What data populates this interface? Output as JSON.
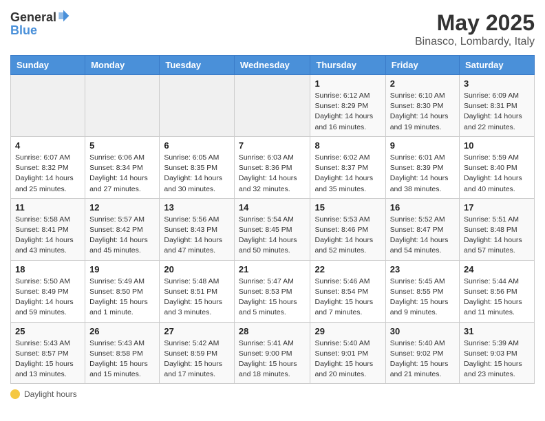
{
  "header": {
    "logo_general": "General",
    "logo_blue": "Blue",
    "month_title": "May 2025",
    "location": "Binasco, Lombardy, Italy"
  },
  "days_of_week": [
    "Sunday",
    "Monday",
    "Tuesday",
    "Wednesday",
    "Thursday",
    "Friday",
    "Saturday"
  ],
  "footer_label": "Daylight hours",
  "weeks": [
    [
      {
        "day": "",
        "info": ""
      },
      {
        "day": "",
        "info": ""
      },
      {
        "day": "",
        "info": ""
      },
      {
        "day": "",
        "info": ""
      },
      {
        "day": "1",
        "info": "Sunrise: 6:12 AM\nSunset: 8:29 PM\nDaylight: 14 hours and 16 minutes."
      },
      {
        "day": "2",
        "info": "Sunrise: 6:10 AM\nSunset: 8:30 PM\nDaylight: 14 hours and 19 minutes."
      },
      {
        "day": "3",
        "info": "Sunrise: 6:09 AM\nSunset: 8:31 PM\nDaylight: 14 hours and 22 minutes."
      }
    ],
    [
      {
        "day": "4",
        "info": "Sunrise: 6:07 AM\nSunset: 8:32 PM\nDaylight: 14 hours and 25 minutes."
      },
      {
        "day": "5",
        "info": "Sunrise: 6:06 AM\nSunset: 8:34 PM\nDaylight: 14 hours and 27 minutes."
      },
      {
        "day": "6",
        "info": "Sunrise: 6:05 AM\nSunset: 8:35 PM\nDaylight: 14 hours and 30 minutes."
      },
      {
        "day": "7",
        "info": "Sunrise: 6:03 AM\nSunset: 8:36 PM\nDaylight: 14 hours and 32 minutes."
      },
      {
        "day": "8",
        "info": "Sunrise: 6:02 AM\nSunset: 8:37 PM\nDaylight: 14 hours and 35 minutes."
      },
      {
        "day": "9",
        "info": "Sunrise: 6:01 AM\nSunset: 8:39 PM\nDaylight: 14 hours and 38 minutes."
      },
      {
        "day": "10",
        "info": "Sunrise: 5:59 AM\nSunset: 8:40 PM\nDaylight: 14 hours and 40 minutes."
      }
    ],
    [
      {
        "day": "11",
        "info": "Sunrise: 5:58 AM\nSunset: 8:41 PM\nDaylight: 14 hours and 43 minutes."
      },
      {
        "day": "12",
        "info": "Sunrise: 5:57 AM\nSunset: 8:42 PM\nDaylight: 14 hours and 45 minutes."
      },
      {
        "day": "13",
        "info": "Sunrise: 5:56 AM\nSunset: 8:43 PM\nDaylight: 14 hours and 47 minutes."
      },
      {
        "day": "14",
        "info": "Sunrise: 5:54 AM\nSunset: 8:45 PM\nDaylight: 14 hours and 50 minutes."
      },
      {
        "day": "15",
        "info": "Sunrise: 5:53 AM\nSunset: 8:46 PM\nDaylight: 14 hours and 52 minutes."
      },
      {
        "day": "16",
        "info": "Sunrise: 5:52 AM\nSunset: 8:47 PM\nDaylight: 14 hours and 54 minutes."
      },
      {
        "day": "17",
        "info": "Sunrise: 5:51 AM\nSunset: 8:48 PM\nDaylight: 14 hours and 57 minutes."
      }
    ],
    [
      {
        "day": "18",
        "info": "Sunrise: 5:50 AM\nSunset: 8:49 PM\nDaylight: 14 hours and 59 minutes."
      },
      {
        "day": "19",
        "info": "Sunrise: 5:49 AM\nSunset: 8:50 PM\nDaylight: 15 hours and 1 minute."
      },
      {
        "day": "20",
        "info": "Sunrise: 5:48 AM\nSunset: 8:51 PM\nDaylight: 15 hours and 3 minutes."
      },
      {
        "day": "21",
        "info": "Sunrise: 5:47 AM\nSunset: 8:53 PM\nDaylight: 15 hours and 5 minutes."
      },
      {
        "day": "22",
        "info": "Sunrise: 5:46 AM\nSunset: 8:54 PM\nDaylight: 15 hours and 7 minutes."
      },
      {
        "day": "23",
        "info": "Sunrise: 5:45 AM\nSunset: 8:55 PM\nDaylight: 15 hours and 9 minutes."
      },
      {
        "day": "24",
        "info": "Sunrise: 5:44 AM\nSunset: 8:56 PM\nDaylight: 15 hours and 11 minutes."
      }
    ],
    [
      {
        "day": "25",
        "info": "Sunrise: 5:43 AM\nSunset: 8:57 PM\nDaylight: 15 hours and 13 minutes."
      },
      {
        "day": "26",
        "info": "Sunrise: 5:43 AM\nSunset: 8:58 PM\nDaylight: 15 hours and 15 minutes."
      },
      {
        "day": "27",
        "info": "Sunrise: 5:42 AM\nSunset: 8:59 PM\nDaylight: 15 hours and 17 minutes."
      },
      {
        "day": "28",
        "info": "Sunrise: 5:41 AM\nSunset: 9:00 PM\nDaylight: 15 hours and 18 minutes."
      },
      {
        "day": "29",
        "info": "Sunrise: 5:40 AM\nSunset: 9:01 PM\nDaylight: 15 hours and 20 minutes."
      },
      {
        "day": "30",
        "info": "Sunrise: 5:40 AM\nSunset: 9:02 PM\nDaylight: 15 hours and 21 minutes."
      },
      {
        "day": "31",
        "info": "Sunrise: 5:39 AM\nSunset: 9:03 PM\nDaylight: 15 hours and 23 minutes."
      }
    ]
  ]
}
